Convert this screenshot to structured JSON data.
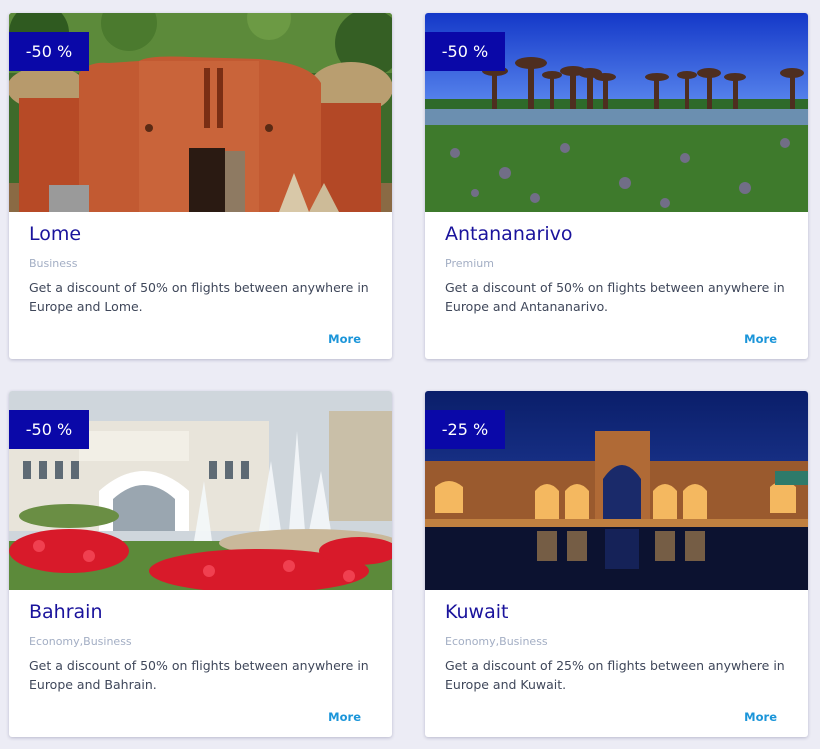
{
  "colors": {
    "background": "#ECECF5",
    "card": "#FFFFFF",
    "badge": "#0A08A8",
    "title": "#1A139C",
    "category": "#A3AEC4",
    "description": "#3F475A",
    "link": "#1B95D9"
  },
  "deals": [
    {
      "badge": "-50 %",
      "city": "Lome",
      "category": "Business",
      "description": "Get a discount of 50% on flights between anywhere in Europe and Lome.",
      "more_label": "More"
    },
    {
      "badge": "-50 %",
      "city": "Antananarivo",
      "category": "Premium",
      "description": "Get a discount of 50% on flights between anywhere in Europe and Antananarivo.",
      "more_label": "More"
    },
    {
      "badge": "-50 %",
      "city": "Bahrain",
      "category": "Economy,Business",
      "description": "Get a discount of 50% on flights between anywhere in Europe and Bahrain.",
      "more_label": "More"
    },
    {
      "badge": "-25 %",
      "city": "Kuwait",
      "category": "Economy,Business",
      "description": "Get a discount of 25% on flights between anywhere in Europe and Kuwait.",
      "more_label": "More"
    }
  ]
}
